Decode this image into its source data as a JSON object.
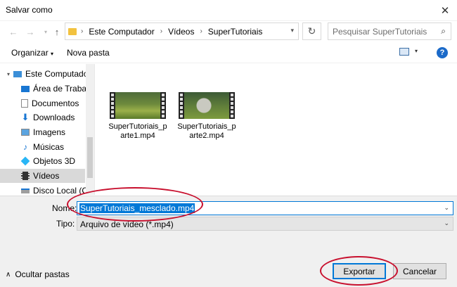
{
  "window": {
    "title": "Salvar como"
  },
  "nav": {
    "breadcrumbs": [
      "Este Computador",
      "Vídeos",
      "SuperTutoriais"
    ],
    "search_placeholder": "Pesquisar SuperTutoriais"
  },
  "toolbar": {
    "organize_label": "Organizar",
    "new_folder_label": "Nova pasta"
  },
  "sidebar": {
    "items": [
      {
        "label": "Este Computador",
        "icon": "computer-icon"
      },
      {
        "label": "Área de Trabalho",
        "icon": "desktop-icon"
      },
      {
        "label": "Documentos",
        "icon": "documents-icon"
      },
      {
        "label": "Downloads",
        "icon": "downloads-icon"
      },
      {
        "label": "Imagens",
        "icon": "pictures-icon"
      },
      {
        "label": "Músicas",
        "icon": "music-icon"
      },
      {
        "label": "Objetos 3D",
        "icon": "3d-objects-icon"
      },
      {
        "label": "Vídeos",
        "icon": "videos-icon",
        "selected": true
      },
      {
        "label": "Disco Local (C:)",
        "icon": "drive-icon"
      }
    ]
  },
  "files": [
    {
      "name": "SuperTutoriais_parte1.mp4"
    },
    {
      "name": "SuperTutoriais_parte2.mp4"
    }
  ],
  "form": {
    "name_label": "Nome:",
    "name_value": "SuperTutoriais_mesclado.mp4",
    "type_label": "Tipo:",
    "type_value": "Arquivo de vídeo (*.mp4)",
    "hide_folders_label": "Ocultar pastas",
    "export_label": "Exportar",
    "cancel_label": "Cancelar"
  },
  "colors": {
    "accent": "#0078d7",
    "annotation": "#c8102e",
    "help": "#1b6ac9"
  }
}
